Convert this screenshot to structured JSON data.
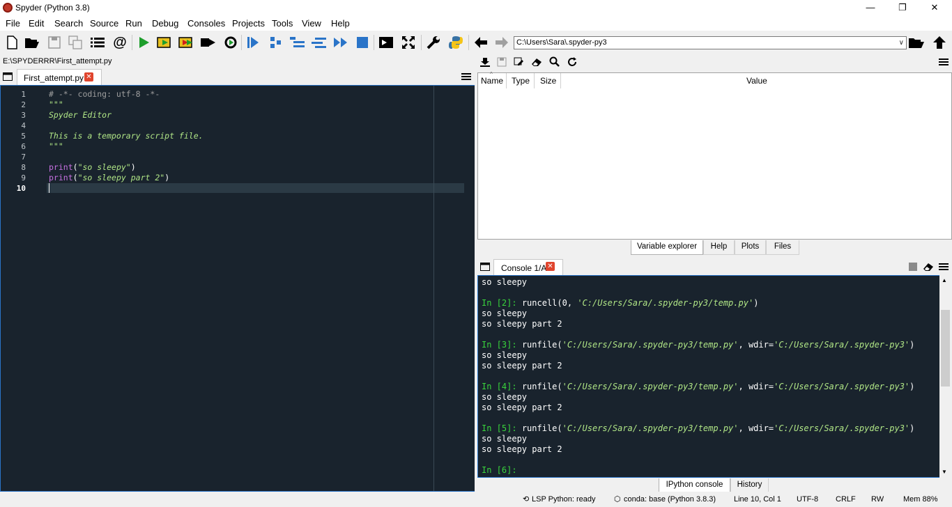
{
  "window": {
    "title": "Spyder (Python 3.8)",
    "minimize": "—",
    "maximize": "❐",
    "close": "✕"
  },
  "menu": [
    "File",
    "Edit",
    "Search",
    "Source",
    "Run",
    "Debug",
    "Consoles",
    "Projects",
    "Tools",
    "View",
    "Help"
  ],
  "toolbar": {
    "working_dir": "C:\\Users\\Sara\\.spyder-py3",
    "icons": [
      "new-file-icon",
      "open-file-icon",
      "save-icon",
      "save-all-icon",
      "outline-icon",
      "at-icon",
      "run-icon",
      "run-cell-icon",
      "run-cell-advance-icon",
      "run-selection-icon",
      "rerun-icon",
      "debug-icon",
      "step-icon",
      "step-into-icon",
      "step-return-icon",
      "continue-icon",
      "stop-icon",
      "maximize-pane-icon",
      "fullscreen-icon",
      "preferences-icon",
      "python-path-icon",
      "back-icon",
      "forward-icon",
      "browse-folder-icon",
      "parent-dir-icon"
    ]
  },
  "editor": {
    "file_path": "E:\\SPYDERRR\\First_attempt.py",
    "tab_label": "First_attempt.py",
    "lines": [
      {
        "n": "1",
        "t": "# -*- coding: utf-8 -*-",
        "k": "comment"
      },
      {
        "n": "2",
        "t": "\"\"\"",
        "k": "str"
      },
      {
        "n": "3",
        "t": "Spyder Editor",
        "k": "str"
      },
      {
        "n": "4",
        "t": "",
        "k": "str"
      },
      {
        "n": "5",
        "t": "This is a temporary script file.",
        "k": "str"
      },
      {
        "n": "6",
        "t": "\"\"\"",
        "k": "str"
      },
      {
        "n": "7",
        "t": "",
        "k": "plain"
      },
      {
        "n": "8",
        "fn": "print",
        "arg": "\"so sleepy\"",
        "k": "call"
      },
      {
        "n": "9",
        "fn": "print",
        "arg": "\"so sleepy part 2\"",
        "k": "call"
      },
      {
        "n": "10",
        "t": "",
        "k": "plain"
      }
    ],
    "current_line": "10"
  },
  "variable_explorer": {
    "headers": {
      "name": "Name",
      "type": "Type",
      "size": "Size",
      "value": "Value"
    },
    "tabs": [
      "Variable explorer",
      "Help",
      "Plots",
      "Files"
    ]
  },
  "console": {
    "tab_label": "Console 1/A",
    "lines": [
      {
        "type": "out",
        "text": "so sleepy"
      },
      {
        "type": "blank"
      },
      {
        "type": "in",
        "num": "2",
        "code": "runcell(0, ",
        "path": "'C:/Users/Sara/.spyder-py3/temp.py'",
        "tail": ")"
      },
      {
        "type": "out",
        "text": "so sleepy"
      },
      {
        "type": "out",
        "text": "so sleepy part 2"
      },
      {
        "type": "blank"
      },
      {
        "type": "in",
        "num": "3",
        "code": "runfile(",
        "path": "'C:/Users/Sara/.spyder-py3/temp.py'",
        "mid": ", wdir=",
        "path2": "'C:/Users/Sara/.spyder-py3'",
        "tail": ")"
      },
      {
        "type": "out",
        "text": "so sleepy"
      },
      {
        "type": "out",
        "text": "so sleepy part 2"
      },
      {
        "type": "blank"
      },
      {
        "type": "in",
        "num": "4",
        "code": "runfile(",
        "path": "'C:/Users/Sara/.spyder-py3/temp.py'",
        "mid": ", wdir=",
        "path2": "'C:/Users/Sara/.spyder-py3'",
        "tail": ")"
      },
      {
        "type": "out",
        "text": "so sleepy"
      },
      {
        "type": "out",
        "text": "so sleepy part 2"
      },
      {
        "type": "blank"
      },
      {
        "type": "in",
        "num": "5",
        "code": "runfile(",
        "path": "'C:/Users/Sara/.spyder-py3/temp.py'",
        "mid": ", wdir=",
        "path2": "'C:/Users/Sara/.spyder-py3'",
        "tail": ")"
      },
      {
        "type": "out",
        "text": "so sleepy"
      },
      {
        "type": "out",
        "text": "so sleepy part 2"
      },
      {
        "type": "blank"
      },
      {
        "type": "in",
        "num": "6",
        "code": ""
      }
    ],
    "bottom_tabs": [
      "IPython console",
      "History"
    ]
  },
  "status": {
    "lsp": "LSP Python: ready",
    "conda": "conda: base (Python 3.8.3)",
    "position": "Line 10, Col 1",
    "encoding": "UTF-8",
    "eol": "CRLF",
    "mode": "RW",
    "mem": "Mem 88%"
  },
  "colors": {
    "accent": "#2a74c8",
    "editor_bg": "#19232d",
    "run_green": "#1e9e2c",
    "close_red": "#e0452e"
  }
}
